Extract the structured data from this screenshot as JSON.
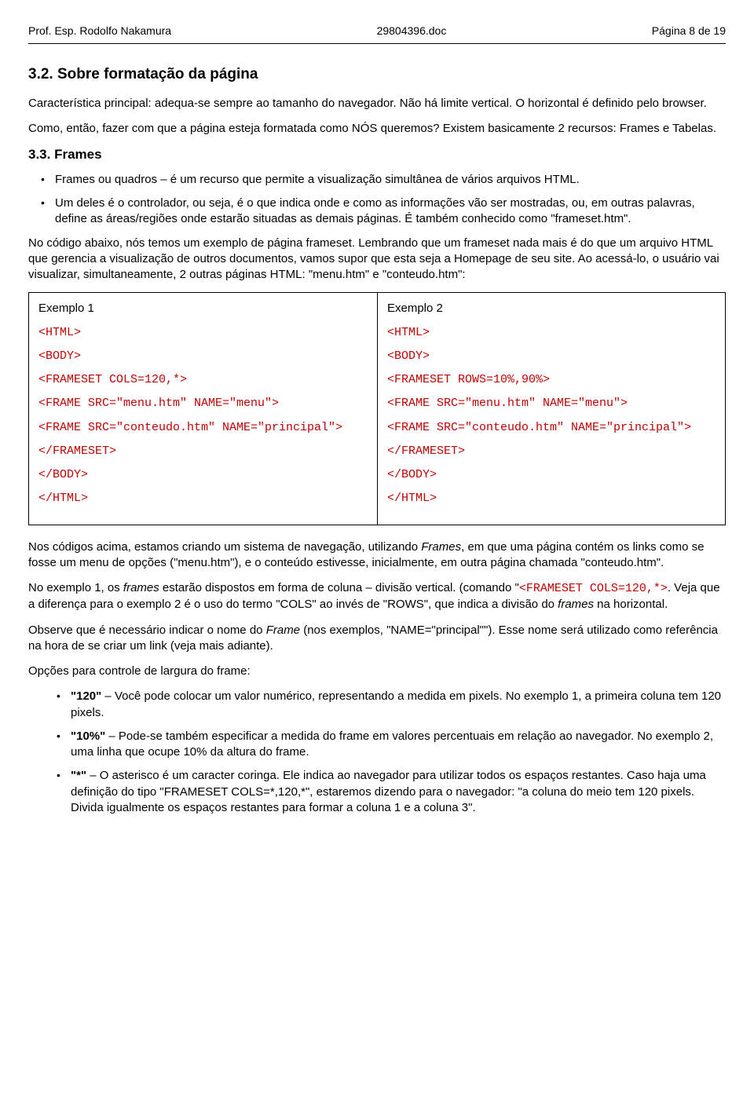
{
  "header": {
    "left": "Prof. Esp. Rodolfo Nakamura",
    "center": "29804396.doc",
    "right": "Página 8 de 19"
  },
  "sec32": {
    "title": "3.2. Sobre formatação da página",
    "p1": "Característica principal: adequa-se sempre ao tamanho do navegador. Não há limite vertical. O horizontal é definido pelo browser.",
    "p2": "Como, então, fazer com que a página esteja formatada como NÓS queremos? Existem basicamente 2 recursos: Frames e Tabelas."
  },
  "sec33": {
    "title": "3.3. Frames",
    "b1": "Frames ou quadros – é um recurso que permite a visualização simultânea de vários arquivos HTML.",
    "b2": "Um deles é o controlador, ou seja, é o que indica onde e como as informações vão ser mostradas, ou, em outras palavras, define as áreas/regiões onde estarão situadas as demais páginas. É também conhecido como \"frameset.htm\".",
    "p_after": "No código abaixo, nós temos um exemplo de página frameset. Lembrando que um frameset nada mais é do que um arquivo HTML que gerencia a visualização de outros documentos, vamos supor que esta seja a Homepage de seu site. Ao acessá-lo, o usuário vai visualizar, simultaneamente, 2 outras páginas HTML: \"menu.htm\" e \"conteudo.htm\":"
  },
  "examples": {
    "left": {
      "title": "Exemplo 1",
      "l1": "<HTML>",
      "l2": "<BODY>",
      "l3": "<FRAMESET COLS=120,*>",
      "l4": "<FRAME SRC=\"menu.htm\" NAME=\"menu\">",
      "l5": "<FRAME SRC=\"conteudo.htm\" NAME=\"principal\">",
      "l6": "</FRAMESET>",
      "l7": "</BODY>",
      "l8": "</HTML>"
    },
    "right": {
      "title": "Exemplo 2",
      "l1": "<HTML>",
      "l2": "<BODY>",
      "l3": "<FRAMESET ROWS=10%,90%>",
      "l4": "<FRAME SRC=\"menu.htm\" NAME=\"menu\">",
      "l5": "<FRAME SRC=\"conteudo.htm\" NAME=\"principal\">",
      "l6": "</FRAMESET>",
      "l7": "</BODY>",
      "l8": "</HTML>"
    }
  },
  "post": {
    "p1a": "Nos códigos acima, estamos criando um sistema de navegação, utilizando ",
    "p1b": "Frames",
    "p1c": ", em que uma página contém os links como se fosse um menu de opções (\"menu.htm\"), e o conteúdo estivesse, inicialmente, em outra página chamada \"conteudo.htm\".",
    "p2a": "No exemplo 1, os ",
    "p2b": "frames",
    "p2c": " estarão dispostos em forma de coluna – divisão vertical. (comando \"",
    "p2cmd": "<FRAMESET COLS=120,*>",
    "p2d": ". Veja que a diferença para o exemplo 2 é o uso do termo \"COLS\" ao invés de \"ROWS\", que indica a divisão do ",
    "p2e": "frames",
    "p2f": " na horizontal.",
    "p3a": "Observe que é necessário indicar o nome do ",
    "p3b": "Frame",
    "p3c": " (nos exemplos, \"NAME=\"principal\"\"). Esse nome será utilizado como referência na hora de se criar um link (veja mais adiante).",
    "p4": "Opções para controle de largura do frame:",
    "opt1a": "\"120\"",
    "opt1b": " – Você pode colocar um valor numérico, representando a medida em pixels. No exemplo 1, a primeira coluna tem 120 pixels.",
    "opt2a": "\"10%\"",
    "opt2b": " – Pode-se também especificar a medida do frame em valores percentuais em relação ao navegador. No exemplo 2, uma linha que ocupe 10% da altura do frame.",
    "opt3a": "\"*\"",
    "opt3b": " – O asterisco é um caracter coringa. Ele indica ao navegador para utilizar todos os espaços restantes. Caso haja uma definição do tipo \"FRAMESET COLS=*,120,*\", estaremos dizendo para o navegador: \"a coluna do meio tem 120 pixels. Divida igualmente os espaços restantes para formar a coluna 1 e a coluna 3\"."
  }
}
